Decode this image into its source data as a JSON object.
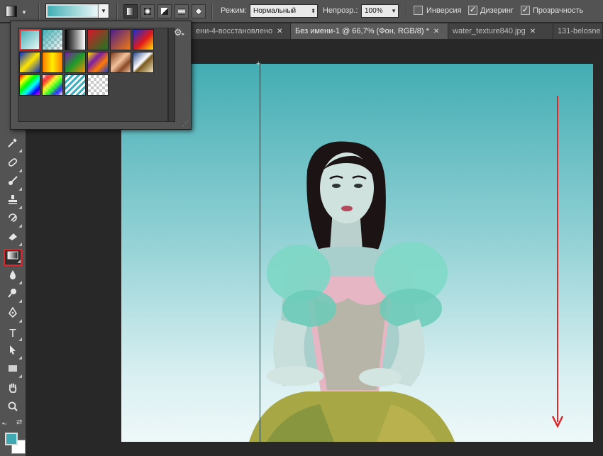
{
  "options_bar": {
    "mode_label": "Режим:",
    "mode_value": "Нормальный",
    "opacity_label": "Непрозр.:",
    "opacity_value": "100%",
    "reverse_label": "Инверсия",
    "reverse_checked": false,
    "dither_label": "Дизеринг",
    "dither_checked": true,
    "transparency_label": "Прозрачность",
    "transparency_checked": true,
    "gradient_colors": [
      "#41afb5",
      "#eaf7f7"
    ],
    "gradient_types": [
      "linear",
      "radial",
      "angle",
      "reflected",
      "diamond"
    ],
    "active_gradient_type": "linear"
  },
  "tabs": [
    {
      "label": "ени-4-восстановлено",
      "active": false
    },
    {
      "label": "Без имени-1 @ 66,7% (Фон, RGB/8) *",
      "active": true
    },
    {
      "label": "water_texture840.jpg",
      "active": false
    },
    {
      "label": "131-belosne",
      "active": false
    }
  ],
  "tools": [
    "eyedropper-icon",
    "healing-brush-icon",
    "brush-icon",
    "clone-stamp-icon",
    "history-brush-icon",
    "eraser-icon",
    "gradient-icon",
    "blur-icon",
    "dodge-icon",
    "pen-icon",
    "type-icon",
    "path-selection-icon",
    "rectangle-icon",
    "hand-icon",
    "zoom-icon"
  ],
  "active_tool": "gradient-icon",
  "tool_glyphs": {
    "type": "T"
  },
  "colors": {
    "foreground": "#3fa8b0",
    "background": "#ffffff",
    "accent_red": "#e0262a"
  },
  "gradient_presets": {
    "selected_index": 0,
    "swatches": [
      "foreground-to-background",
      "foreground-to-transparent",
      "black-white",
      "red-green",
      "violet-orange",
      "blue-red-yellow",
      "blue-yellow-blue",
      "orange-yellow-orange",
      "violet-green-orange",
      "yellow-violet-orange-blue",
      "copper",
      "chrome",
      "spectrum",
      "transparent-rainbow",
      "transparent-stripes",
      "checker-transparent"
    ]
  }
}
